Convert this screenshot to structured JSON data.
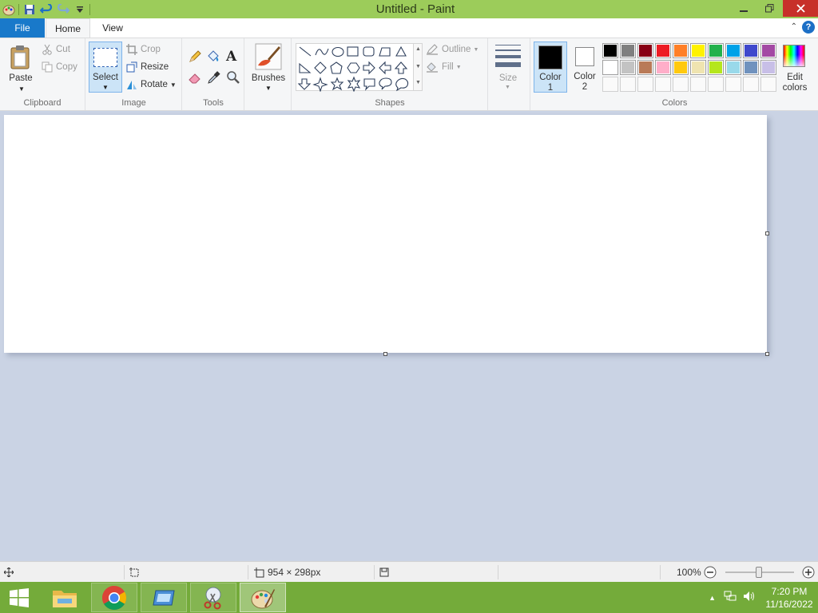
{
  "window": {
    "title": "Untitled - Paint"
  },
  "tabs": {
    "file": "File",
    "home": "Home",
    "view": "View"
  },
  "ribbon": {
    "clipboard": {
      "paste": "Paste",
      "cut": "Cut",
      "copy": "Copy",
      "label": "Clipboard"
    },
    "image": {
      "select": "Select",
      "crop": "Crop",
      "resize": "Resize",
      "rotate": "Rotate",
      "label": "Image"
    },
    "tools": {
      "label": "Tools"
    },
    "brushes": {
      "label": "Brushes"
    },
    "shapes": {
      "outline": "Outline",
      "fill": "Fill",
      "label": "Shapes"
    },
    "size": {
      "label": "Size"
    },
    "colors": {
      "color1_line1": "Color",
      "color1_line2": "1",
      "color2_line1": "Color",
      "color2_line2": "2",
      "edit_line1": "Edit",
      "edit_line2": "colors",
      "label": "Colors",
      "color1_value": "#000000",
      "color2_value": "#ffffff",
      "palette_row1": [
        "#000000",
        "#7f7f7f",
        "#880015",
        "#ed1c24",
        "#ff7f27",
        "#fff200",
        "#22b14c",
        "#00a2e8",
        "#3f48cc",
        "#a349a4"
      ],
      "palette_row2": [
        "#ffffff",
        "#c3c3c3",
        "#b97a57",
        "#ffaec9",
        "#ffc90e",
        "#efe4b0",
        "#b5e61d",
        "#99d9ea",
        "#7092be",
        "#c8bfe7"
      ]
    }
  },
  "status": {
    "dimensions": "954 × 298px",
    "zoom": "100%",
    "zoom_level": 0.5
  },
  "taskbar": {
    "time": "7:20 PM",
    "date": "11/16/2022"
  }
}
